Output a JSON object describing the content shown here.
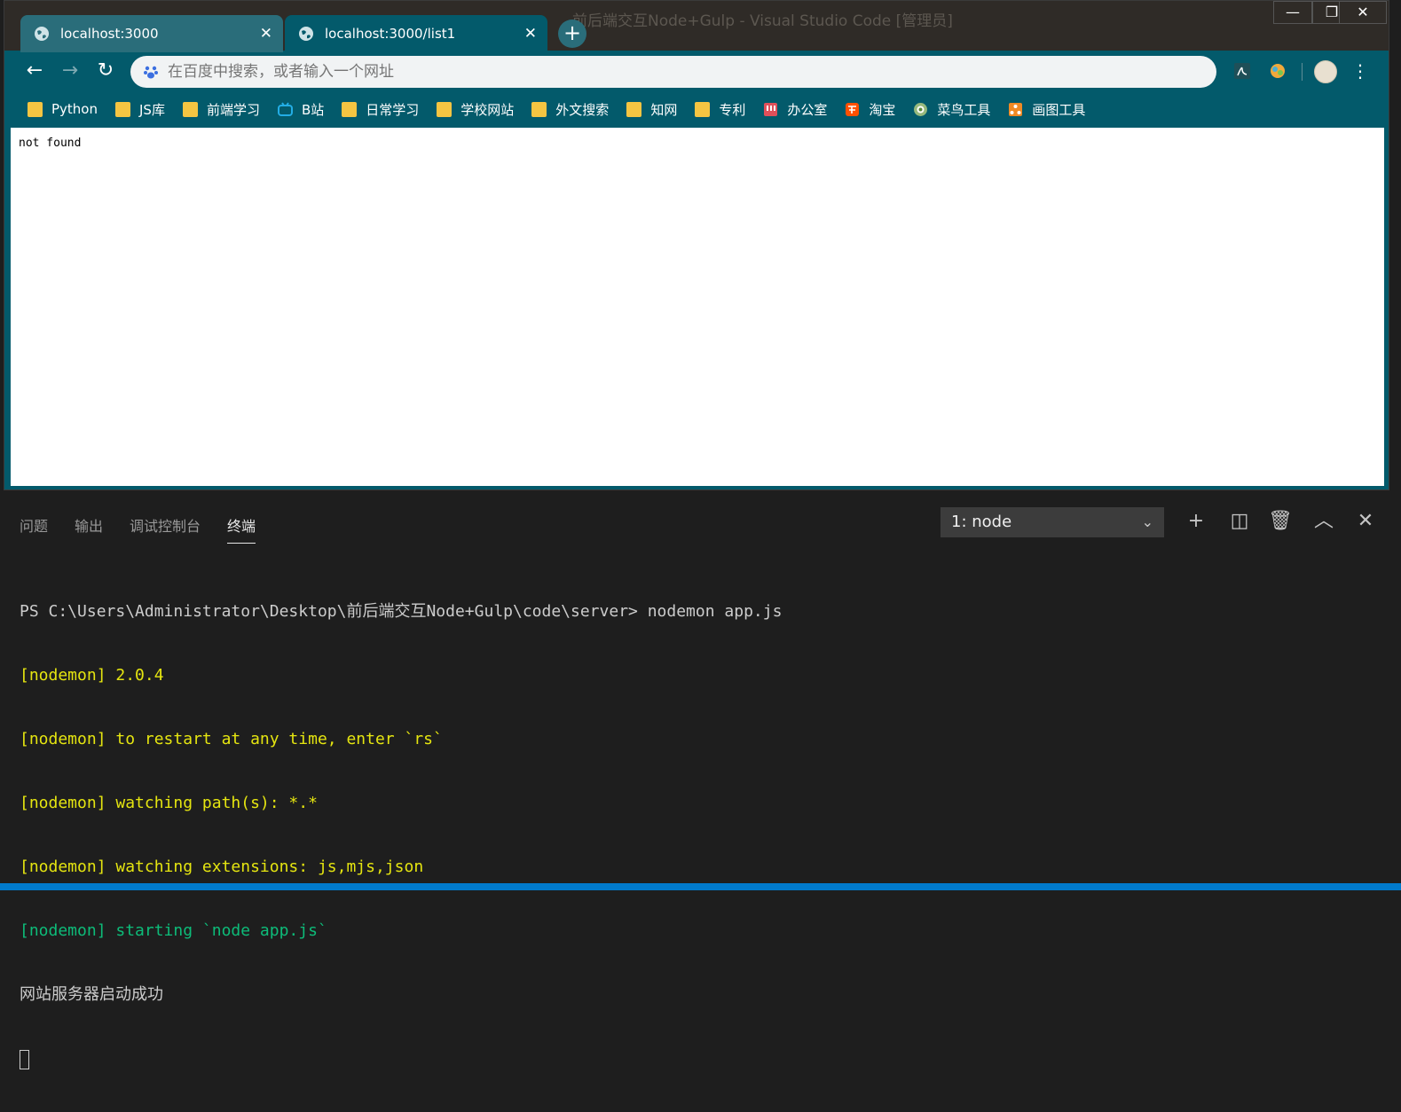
{
  "browser": {
    "tabs": [
      {
        "title": "localhost:3000",
        "active": false
      },
      {
        "title": "localhost:3000/list1",
        "active": true
      }
    ],
    "window_title_faded": "前后端交互Node+Gulp - Visual Studio Code [管理员]",
    "omnibox_placeholder": "在百度中搜索，或者输入一个网址",
    "bookmarks": [
      {
        "label": "Python",
        "icon": "folder-icon"
      },
      {
        "label": "JS库",
        "icon": "folder-icon"
      },
      {
        "label": "前端学习",
        "icon": "folder-icon"
      },
      {
        "label": "B站",
        "icon": "bilibili-icon"
      },
      {
        "label": "日常学习",
        "icon": "folder-icon"
      },
      {
        "label": "学校网站",
        "icon": "folder-icon"
      },
      {
        "label": "外文搜索",
        "icon": "folder-icon"
      },
      {
        "label": "知网",
        "icon": "folder-icon"
      },
      {
        "label": "专利",
        "icon": "folder-icon"
      },
      {
        "label": "办公室",
        "icon": "office-icon"
      },
      {
        "label": "淘宝",
        "icon": "taobao-icon"
      },
      {
        "label": "菜鸟工具",
        "icon": "runoob-icon"
      },
      {
        "label": "画图工具",
        "icon": "draw-tool-icon"
      }
    ],
    "page_text": "not found"
  },
  "panel": {
    "tabs": [
      "问题",
      "输出",
      "调试控制台",
      "终端"
    ],
    "active_tab": "终端",
    "terminal_select": "1: node",
    "lines": [
      {
        "text": "PS C:\\Users\\Administrator\\Desktop\\前后端交互Node+Gulp\\code\\server> nodemon app.js",
        "color": "white"
      },
      {
        "text": "[nodemon] 2.0.4",
        "color": "yellow"
      },
      {
        "text": "[nodemon] to restart at any time, enter `rs`",
        "color": "yellow"
      },
      {
        "text": "[nodemon] watching path(s): *.*",
        "color": "yellow"
      },
      {
        "text": "[nodemon] watching extensions: js,mjs,json",
        "color": "yellow"
      },
      {
        "text": "[nodemon] starting `node app.js`",
        "color": "green"
      },
      {
        "text": "网站服务器启动成功",
        "color": "white"
      }
    ]
  },
  "colors": {
    "browser_frame": "#035a6b",
    "terminal_yellow": "#e5e510",
    "terminal_green": "#0dbc79",
    "status_bar": "#007acc"
  }
}
